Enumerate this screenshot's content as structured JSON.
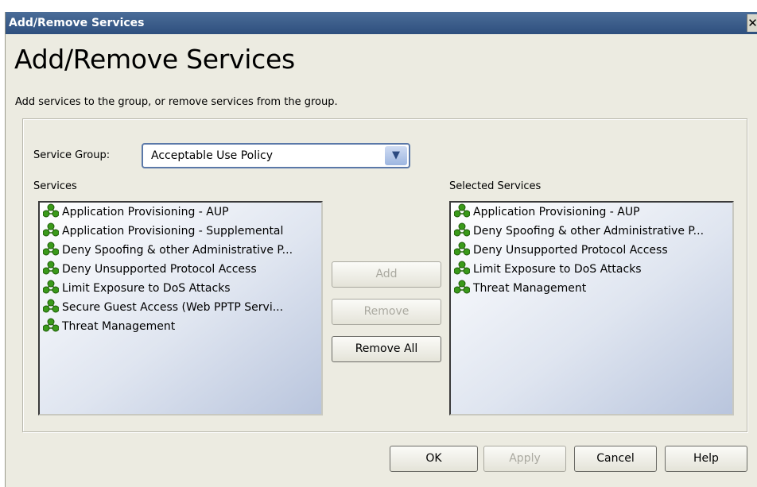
{
  "window": {
    "title": "Add/Remove Services",
    "close_glyph": "✕"
  },
  "heading": "Add/Remove Services",
  "description": "Add services to the group, or remove services from the group.",
  "service_group": {
    "label": "Service Group:",
    "value": "Acceptable Use Policy"
  },
  "services": {
    "label": "Services",
    "items": [
      "Application Provisioning - AUP",
      "Application Provisioning - Supplemental",
      "Deny Spoofing & other Administrative P...",
      "Deny Unsupported Protocol Access",
      "Limit Exposure to DoS Attacks",
      "Secure Guest Access (Web PPTP Servi...",
      "Threat Management"
    ]
  },
  "selected_services": {
    "label": "Selected Services",
    "items": [
      "Application Provisioning - AUP",
      "Deny Spoofing & other Administrative P...",
      "Deny Unsupported Protocol Access",
      "Limit Exposure to DoS Attacks",
      "Threat Management"
    ]
  },
  "transfer_buttons": {
    "add": "Add",
    "remove": "Remove",
    "remove_all": "Remove All"
  },
  "footer_buttons": {
    "ok": "OK",
    "apply": "Apply",
    "cancel": "Cancel",
    "help": "Help"
  },
  "icons": {
    "service_item": "service-node-icon",
    "combo_arrow": "chevron-down-icon"
  },
  "colors": {
    "titlebar": "#2e4f7e",
    "dialog_bg": "#ecebe1",
    "service_icon": "#3a9a1a"
  }
}
